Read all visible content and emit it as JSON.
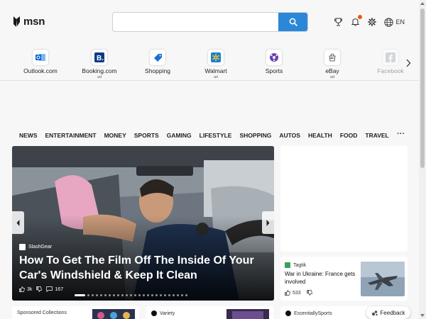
{
  "header": {
    "logo_text": "msn",
    "search": {
      "value": "",
      "placeholder": ""
    },
    "lang_label": "EN",
    "icons": [
      "rewards-trophy-icon",
      "notifications-bell-icon",
      "settings-gear-icon",
      "globe-icon"
    ],
    "accent": "#2b88d8",
    "notif_dot_color": "#e8591a"
  },
  "quick_links": [
    {
      "label": "Outlook.com",
      "ad": "",
      "icon": "outlook-icon",
      "color": "#0a64c9"
    },
    {
      "label": "Booking.com",
      "ad": "ad",
      "icon": "booking-icon",
      "color": "#0a3b88"
    },
    {
      "label": "Shopping",
      "ad": "",
      "icon": "shopping-tag-icon",
      "color": "#1b6fd6"
    },
    {
      "label": "Walmart",
      "ad": "ad",
      "icon": "walmart-icon",
      "color": "#1a7fd4"
    },
    {
      "label": "Sports",
      "ad": "",
      "icon": "sports-ball-icon",
      "color": "#6a3fb5"
    },
    {
      "label": "eBay",
      "ad": "ad",
      "icon": "ebay-icon",
      "color": "#e53238"
    },
    {
      "label": "Facebook",
      "ad": "",
      "icon": "facebook-icon",
      "color": "#1877f2"
    }
  ],
  "nav": {
    "items": [
      "NEWS",
      "ENTERTAINMENT",
      "MONEY",
      "SPORTS",
      "GAMING",
      "LIFESTYLE",
      "SHOPPING",
      "AUTOS",
      "HEALTH",
      "FOOD",
      "TRAVEL"
    ],
    "more": "···"
  },
  "hero": {
    "source": "SlashGear",
    "title": "How To Get The Film Off The Inside Of Your Car's Windshield & Keep It Clean",
    "likes": "3k",
    "comments": "167",
    "slide_count": 25,
    "active_slide": 0
  },
  "news_card": {
    "source": "Tagtik",
    "title": "War in Ukraine: France gets involved",
    "likes": "533"
  },
  "bottom_cards": [
    {
      "label": "Sponsored Collections"
    },
    {
      "label": "Variety"
    },
    {
      "label": "EssentiallySports"
    }
  ],
  "feedback_label": "Feedback"
}
